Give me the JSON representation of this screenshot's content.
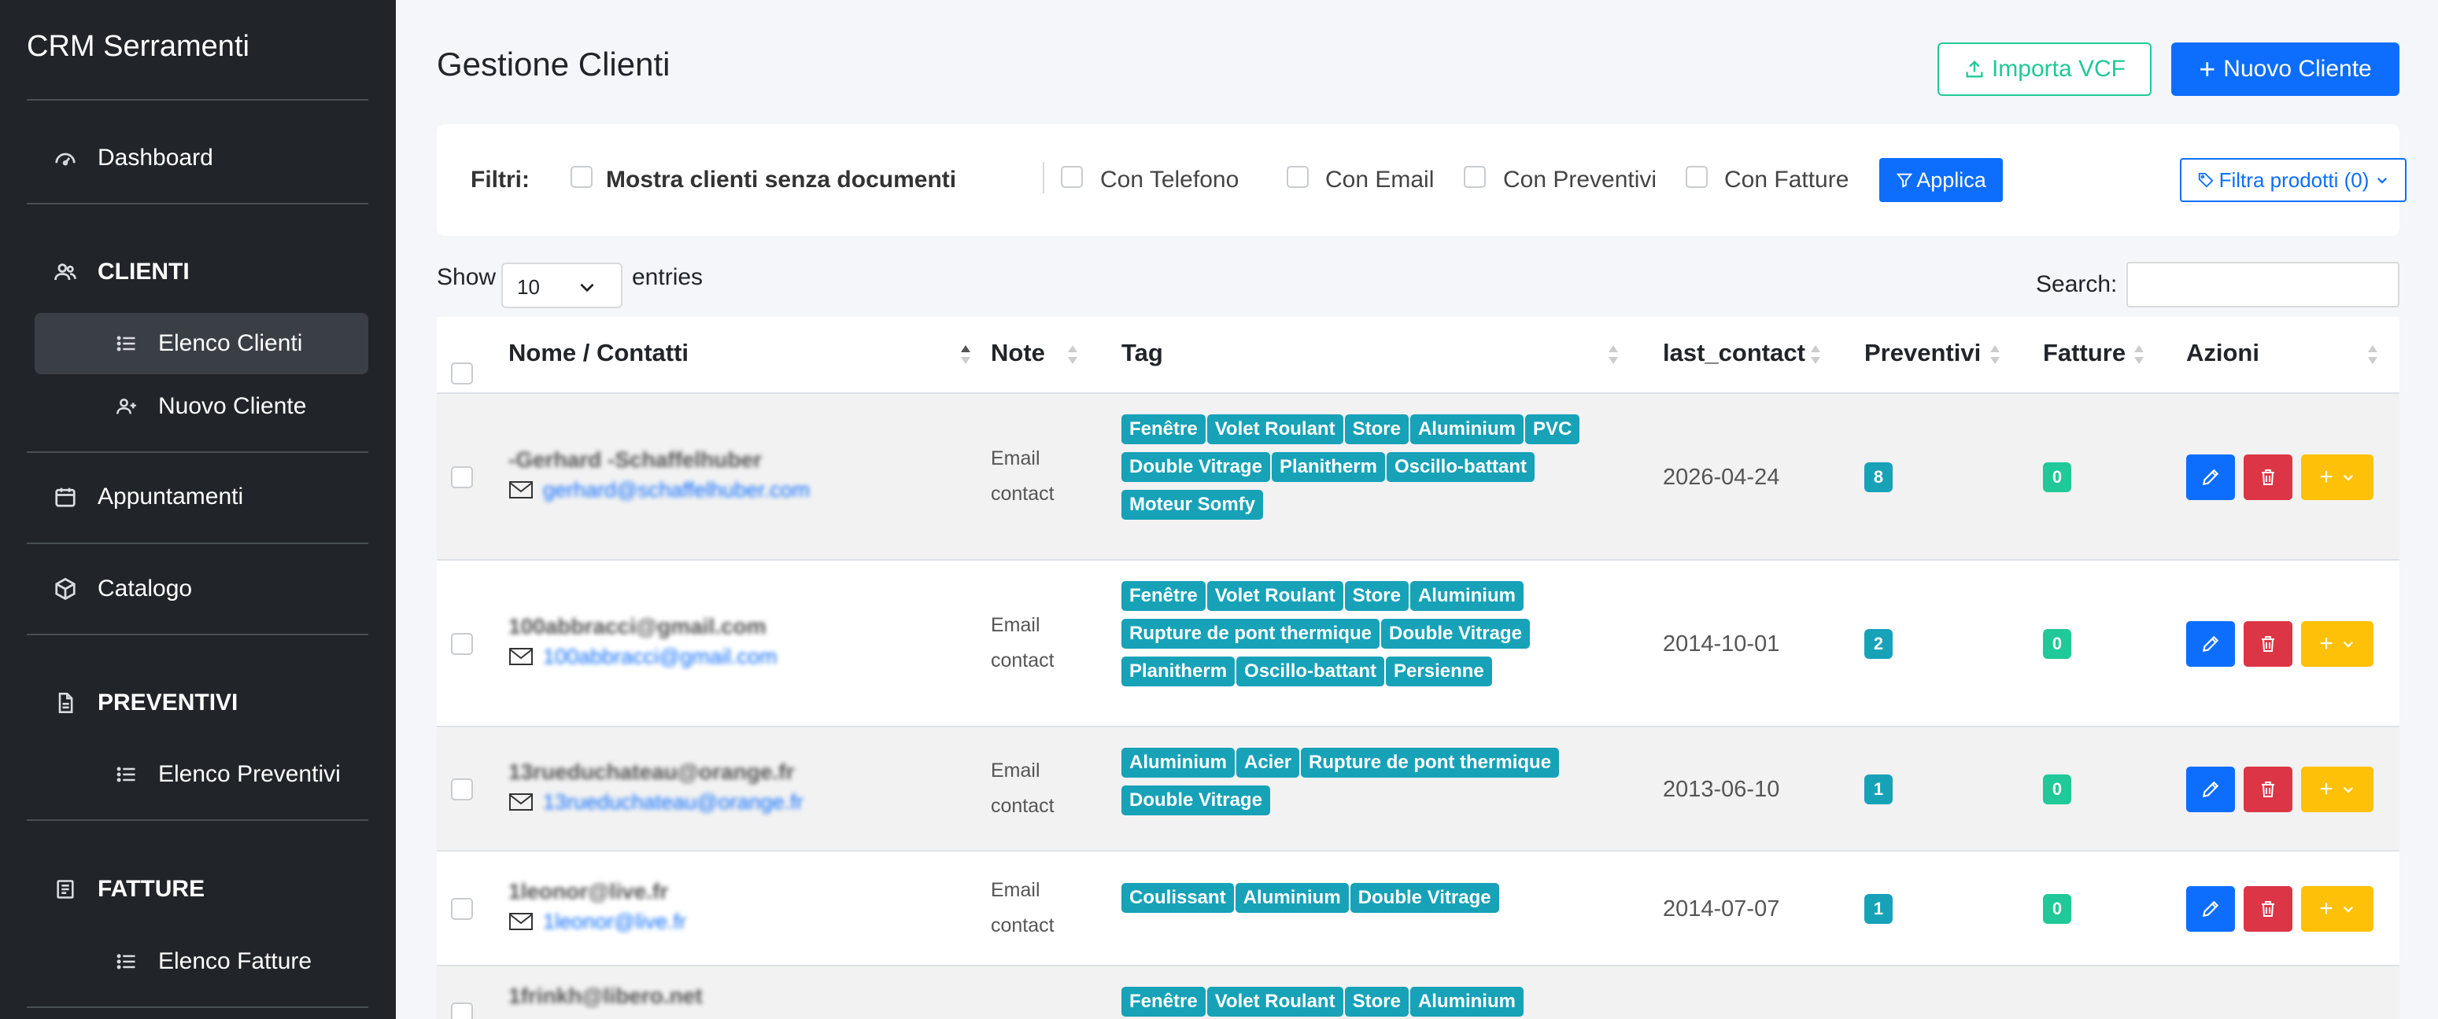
{
  "sidebar": {
    "brand": "CRM Serramenti",
    "dashboard": "Dashboard",
    "clienti_head": "CLIENTI",
    "elenco_clienti": "Elenco Clienti",
    "nuovo_cliente": "Nuovo Cliente",
    "appuntamenti": "Appuntamenti",
    "catalogo": "Catalogo",
    "preventivi_head": "PREVENTIVI",
    "elenco_preventivi": "Elenco Preventivi",
    "fatture_head": "FATTURE",
    "elenco_fatture": "Elenco Fatture"
  },
  "header": {
    "title": "Gestione Clienti",
    "import_label": "Importa VCF",
    "new_label": "Nuovo Cliente"
  },
  "filters": {
    "label": "Filtri:",
    "no_docs": "Mostra clienti senza documenti",
    "phone": "Con Telefono",
    "email": "Con Email",
    "quotes": "Con Preventivi",
    "invoices": "Con Fatture",
    "apply": "Applica",
    "products": "Filtra prodotti (0)"
  },
  "table_controls": {
    "show": "Show",
    "length": "10",
    "entries": "entries",
    "search": "Search:"
  },
  "columns": {
    "name": "Nome / Contatti",
    "note": "Note",
    "tag": "Tag",
    "last_contact": "last_contact",
    "preventivi": "Preventivi",
    "fatture": "Fatture",
    "azioni": "Azioni"
  },
  "rows": [
    {
      "name": "-Gerhard -Schaffelhuber",
      "email": "gerhard@schaffelhuber.com",
      "note": "Email contact",
      "tags": [
        "Fenêtre",
        "Volet Roulant",
        "Store",
        "Aluminium",
        "PVC",
        "Double Vitrage",
        "Planitherm",
        "Oscillo-battant",
        "Moteur Somfy"
      ],
      "date": "2026-04-24",
      "preventivi": "8",
      "fatture": "0"
    },
    {
      "name": "100abbracci@gmail.com",
      "email": "100abbracci@gmail.com",
      "note": "Email contact",
      "tags": [
        "Fenêtre",
        "Volet Roulant",
        "Store",
        "Aluminium",
        "Rupture de pont thermique",
        "Double Vitrage",
        "Planitherm",
        "Oscillo-battant",
        "Persienne"
      ],
      "date": "2014-10-01",
      "preventivi": "2",
      "fatture": "0"
    },
    {
      "name": "13rueduchateau@orange.fr",
      "email": "13rueduchateau@orange.fr",
      "note": "Email contact",
      "tags": [
        "Aluminium",
        "Acier",
        "Rupture de pont thermique",
        "Double Vitrage"
      ],
      "date": "2013-06-10",
      "preventivi": "1",
      "fatture": "0"
    },
    {
      "name": "1leonor@live.fr",
      "email": "1leonor@live.fr",
      "note": "Email contact",
      "tags": [
        "Coulissant",
        "Aluminium",
        "Double Vitrage"
      ],
      "date": "2014-07-07",
      "preventivi": "1",
      "fatture": "0"
    },
    {
      "name": "1frinkh@libero.net",
      "email": "",
      "note": "",
      "tags": [
        "Fenêtre",
        "Volet Roulant",
        "Store",
        "Aluminium"
      ],
      "date": "",
      "preventivi": "",
      "fatture": ""
    }
  ],
  "colors": {
    "sidebar_bg": "#212529",
    "primary": "#0d6efd",
    "success": "#20c997",
    "info": "#17a2b8",
    "danger": "#dc3545",
    "warning": "#ffc107"
  }
}
